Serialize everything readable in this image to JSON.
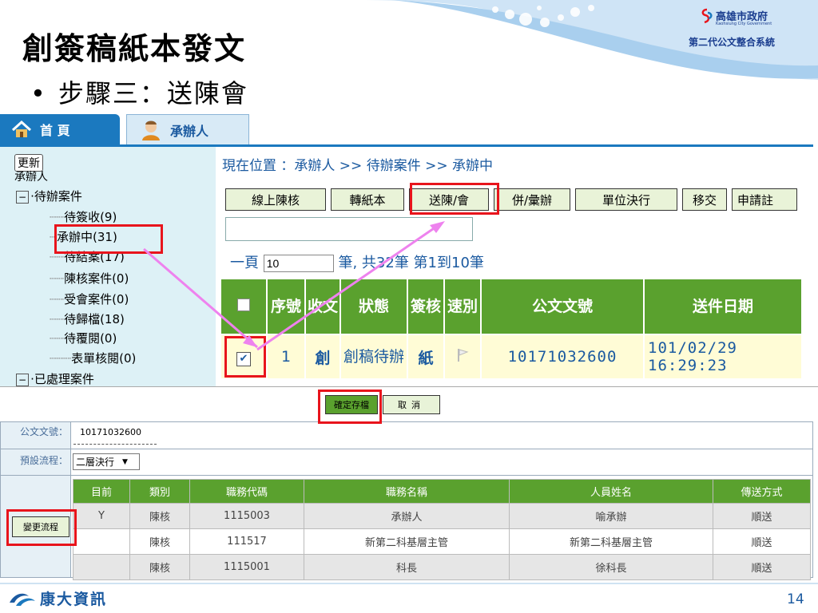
{
  "slide": {
    "title": "創簽稿紙本發文",
    "bullet": "步驟三：送陳會",
    "page_number": "14"
  },
  "logo": {
    "org": "高雄市政府",
    "org_en": "Kaohsiung City Government",
    "system": "第二代公文整合系統"
  },
  "footer": {
    "company": "康大資訊"
  },
  "tabs": {
    "home": "首 頁",
    "handler": "承辦人"
  },
  "tree": {
    "refresh": "更新",
    "root": "承辦人",
    "pending_group": "待辦案件",
    "items": [
      "待簽收(9)",
      "承辦中(31)",
      "待結案(17)",
      "陳核案件(0)",
      "受會案件(0)",
      "待歸檔(18)",
      "待覆閱(0)",
      "表單核閱(0)"
    ],
    "processed_group": "已處理案件"
  },
  "breadcrumb": "現在位置 ：承辦人 >> 待辦案件 >> 承辦中",
  "toolbar": [
    "線上陳核",
    "轉紙本",
    "送陳/會",
    "併/彙辦",
    "單位決行",
    "移交",
    "申請註"
  ],
  "pager": {
    "prefix": "一頁",
    "page_size": "10",
    "summary": "筆, 共32筆 第1到10筆"
  },
  "grid": {
    "headers": [
      "序號",
      "收文",
      "狀態",
      "簽核",
      "速別",
      "公文文號",
      "送件日期"
    ],
    "row": {
      "seq": "1",
      "recv": "創",
      "status": "創稿待辦",
      "sign": "紙",
      "doc_no": "10171032600",
      "date": "101/02/29 16:29:23"
    }
  },
  "form": {
    "save": "確定存檔",
    "cancel": "取消",
    "doc_no_label": "公文文號：",
    "doc_no": "10171032600",
    "flow_label": "預設流程：",
    "flow_value": "二層決行",
    "change_flow": "變更流程",
    "headers": [
      "目前",
      "類別",
      "職務代碼",
      "職務名稱",
      "人員姓名",
      "傳送方式"
    ],
    "rows": [
      [
        "Y",
        "陳核",
        "1115003",
        "承辦人",
        "喻承辦",
        "順送"
      ],
      [
        "",
        "陳核",
        "111517",
        "新第二科基層主管",
        "新第二科基層主管",
        "順送"
      ],
      [
        "",
        "陳核",
        "1115001",
        "科長",
        "徐科長",
        "順送"
      ]
    ]
  },
  "colors": {
    "accent_green": "#5aa12e",
    "highlight_red": "#e8141c",
    "arrow_pink": "#ee82ee",
    "link_blue": "#1b5aa0"
  }
}
